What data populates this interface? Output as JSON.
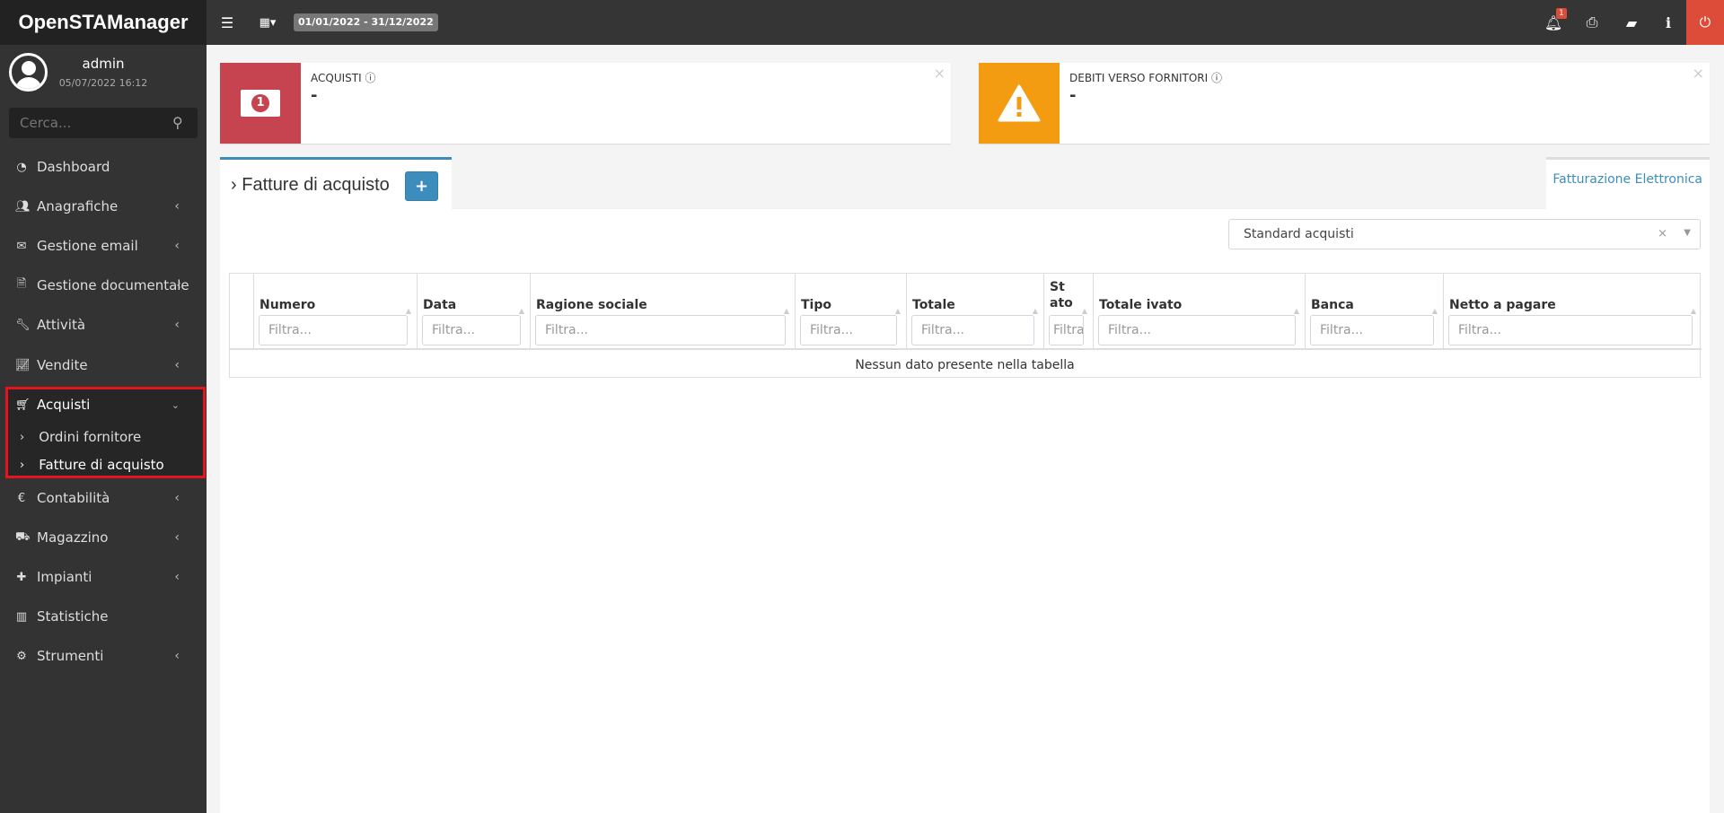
{
  "app": {
    "title": "OpenSTAManager"
  },
  "topbar": {
    "date_range": "01/01/2022 - 31/12/2022",
    "notification_count": "1",
    "icons": [
      "menu-icon",
      "calendar-icon",
      "bell-icon",
      "print-icon",
      "book-icon",
      "info-icon",
      "power-icon"
    ],
    "power_color": "#dd4b39"
  },
  "user": {
    "name": "admin",
    "datetime": "05/07/2022 16:12"
  },
  "search": {
    "placeholder": "Cerca..."
  },
  "sidebar": {
    "items": [
      {
        "label": "Dashboard",
        "icon": "dashboard-icon"
      },
      {
        "label": "Anagrafiche",
        "icon": "users-icon"
      },
      {
        "label": "Gestione email",
        "icon": "envelope-icon"
      },
      {
        "label": "Gestione documentale",
        "icon": "file-icon"
      },
      {
        "label": "Attività",
        "icon": "wrench-icon"
      },
      {
        "label": "Vendite",
        "icon": "line-chart-icon"
      },
      {
        "label": "Acquisti",
        "icon": "cart-icon",
        "expanded": true,
        "children": [
          {
            "label": "Ordini fornitore"
          },
          {
            "label": "Fatture di acquisto",
            "active": true
          }
        ]
      },
      {
        "label": "Contabilità",
        "icon": "euro-icon"
      },
      {
        "label": "Magazzino",
        "icon": "truck-icon"
      },
      {
        "label": "Impianti",
        "icon": "puzzle-icon"
      },
      {
        "label": "Statistiche",
        "icon": "bar-chart-icon"
      },
      {
        "label": "Strumenti",
        "icon": "gear-icon"
      }
    ]
  },
  "infoboxes": [
    {
      "title": "ACQUISTI",
      "value": "-",
      "color": "#c5444f",
      "icon": "money-icon"
    },
    {
      "title": "DEBITI VERSO FORNITORI",
      "value": "-",
      "color": "#f39c12",
      "icon": "warning-icon"
    }
  ],
  "main": {
    "tab_title": "Fatture di acquisto",
    "add_label": "+",
    "tab2_label": "Fatturazione Elettronica",
    "segment_select": "Standard acquisti",
    "table": {
      "columns": [
        "Numero",
        "Data",
        "Ragione sociale",
        "Tipo",
        "Totale",
        "Stato",
        "Totale ivato",
        "Banca",
        "Netto a pagare"
      ],
      "filter_placeholder": "Filtra...",
      "empty_message": "Nessun dato presente nella tabella"
    }
  }
}
